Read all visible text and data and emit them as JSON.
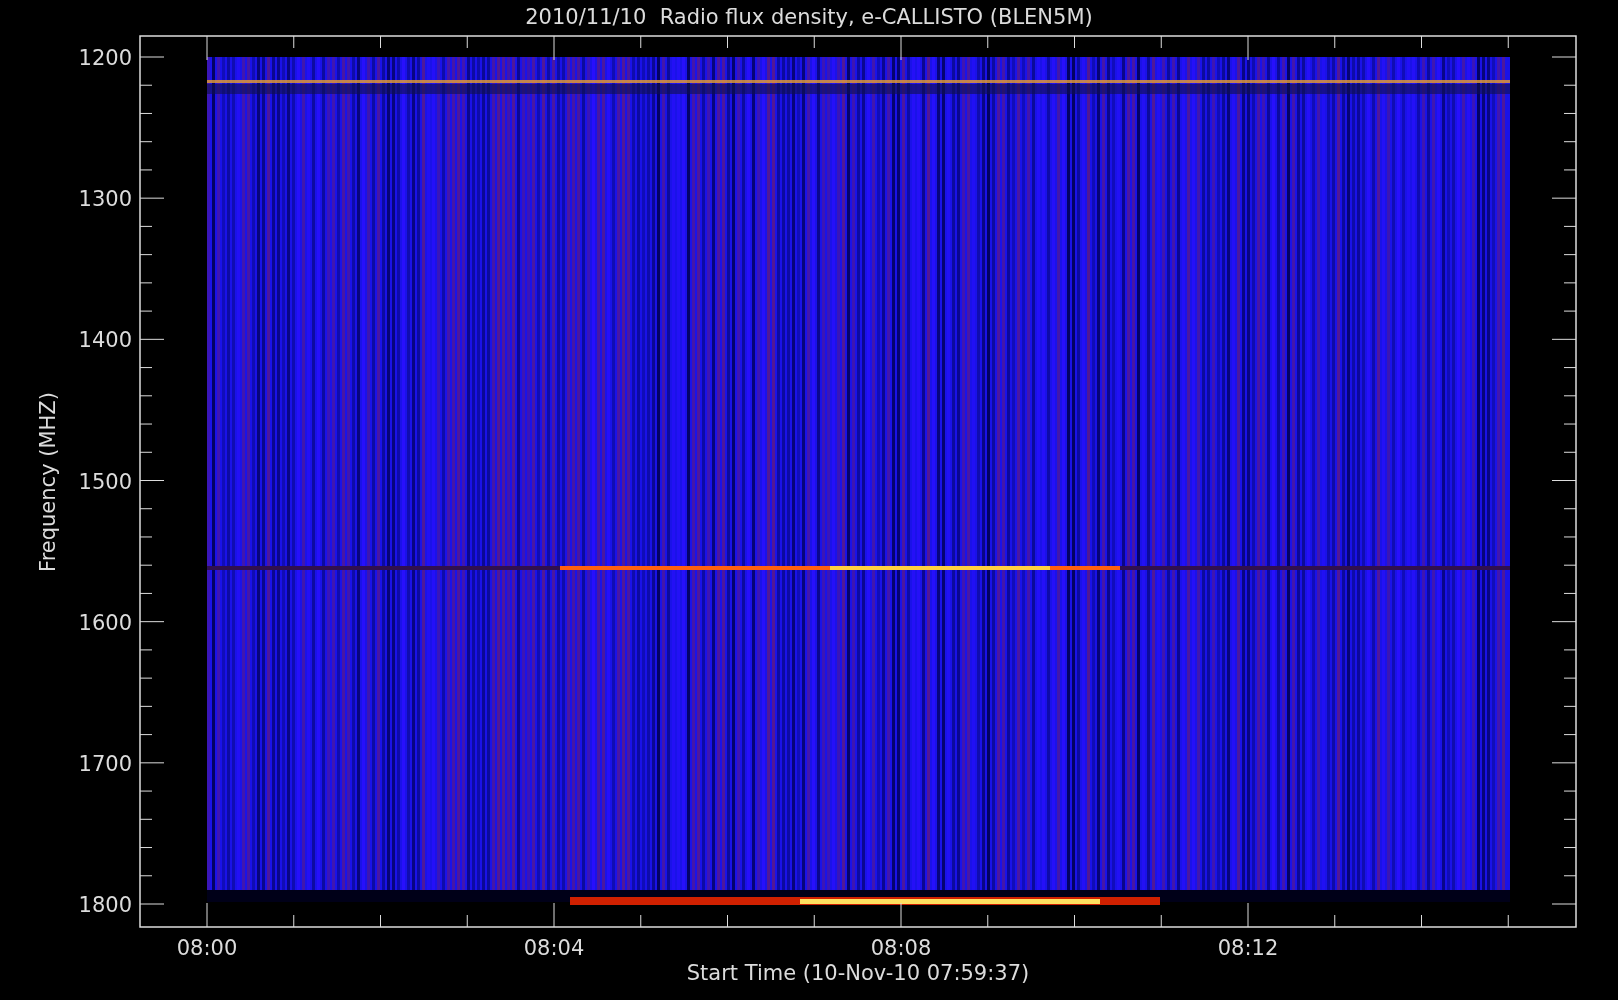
{
  "title": "2010/11/10  Radio flux density, e-CALLISTO (BLEN5M)",
  "y_axis": {
    "label": "Frequency (MHZ)",
    "ticks": [
      "1200",
      "1300",
      "1400",
      "1500",
      "1600",
      "1700",
      "1800"
    ]
  },
  "x_axis": {
    "label": "Start Time (10-Nov-10 07:59:37)",
    "ticks": [
      "08:00",
      "08:04",
      "08:08",
      "08:12"
    ]
  }
}
